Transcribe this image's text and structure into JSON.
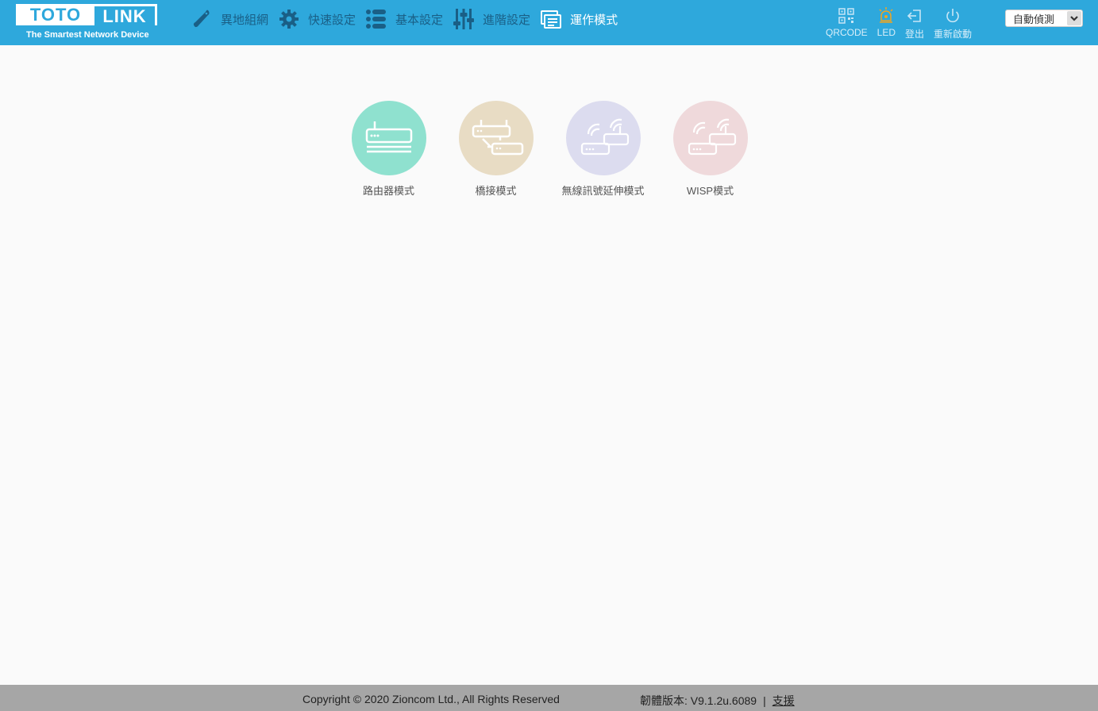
{
  "brand": {
    "logo_left": "TOTO",
    "logo_right": "LINK",
    "tagline": "The Smartest Network Device"
  },
  "nav": [
    {
      "id": "mesh",
      "label": "異地組網",
      "icon": "wrench-icon"
    },
    {
      "id": "quick",
      "label": "快速設定",
      "icon": "gear-icon"
    },
    {
      "id": "basic",
      "label": "基本設定",
      "icon": "list-icon"
    },
    {
      "id": "advanced",
      "label": "進階設定",
      "icon": "sliders-icon"
    },
    {
      "id": "mode",
      "label": "運作模式",
      "icon": "mode-icon",
      "active": true
    }
  ],
  "tools": [
    {
      "id": "qrcode",
      "label": "QRCODE",
      "icon": "qrcode-icon"
    },
    {
      "id": "led",
      "label": "LED",
      "icon": "led-icon"
    },
    {
      "id": "logout",
      "label": "登出",
      "icon": "logout-icon"
    },
    {
      "id": "reboot",
      "label": "重新啟動",
      "icon": "power-icon"
    }
  ],
  "language": {
    "selected": "自動偵測"
  },
  "modes": [
    {
      "id": "router",
      "label": "路由器模式",
      "color": "#8fe1cf"
    },
    {
      "id": "bridge",
      "label": "橋接模式",
      "color": "#e8dcc4"
    },
    {
      "id": "repeater",
      "label": "無線訊號延伸模式",
      "color": "#dcdcef"
    },
    {
      "id": "wisp",
      "label": "WISP模式",
      "color": "#efd9db"
    }
  ],
  "footer": {
    "copyright": "Copyright © 2020 Zioncom Ltd., All Rights Reserved",
    "firmware": "韌體版本: V9.1.2u.6089",
    "separator": "|",
    "support": "支援"
  },
  "colors": {
    "header": "#2ea8dc",
    "nav_text": "#1a5f86",
    "footer": "#a6a6a6",
    "led": "#f1a51f"
  }
}
